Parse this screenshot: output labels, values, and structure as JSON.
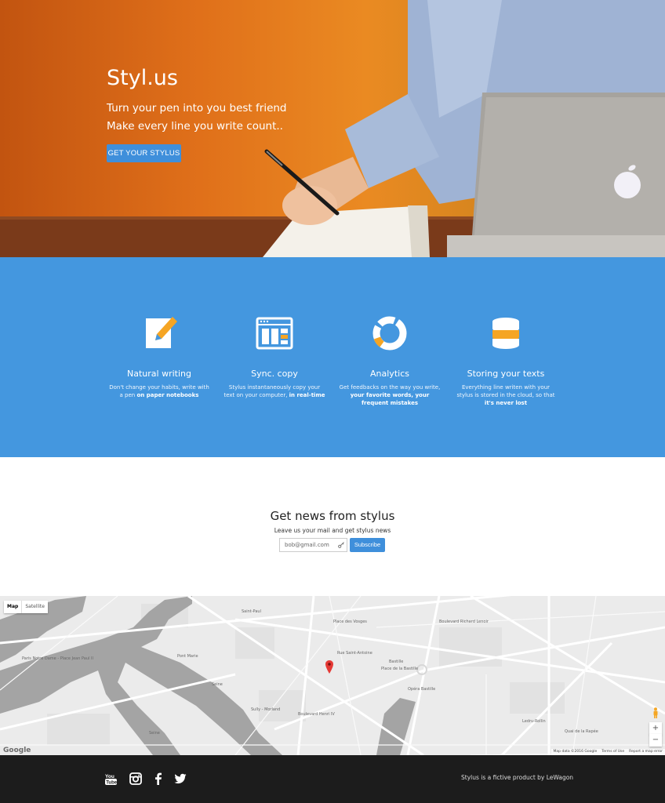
{
  "hero": {
    "title": "Styl.us",
    "line1": "Turn your pen into you best friend",
    "line2": "Make every line you write count..",
    "cta_label": "GET YOUR STYLUS"
  },
  "features": [
    {
      "icon": "pencil-note-icon",
      "title": "Natural writing",
      "text": "Don't change your habits, write with a pen ",
      "bold": "on paper notebooks"
    },
    {
      "icon": "layout-window-icon",
      "title": "Sync. copy",
      "text": "Stylus instantaneously copy your text on your computer, ",
      "bold": "in real-time"
    },
    {
      "icon": "donut-chart-icon",
      "title": "Analytics",
      "text": "Get feedbacks on the way you write, ",
      "bold": "your favorite words, your frequent mistakes"
    },
    {
      "icon": "database-icon",
      "title": "Storing your texts",
      "text": "Everything line writen with your stylus is stored in the cloud, so that ",
      "bold": "it's never lost"
    }
  ],
  "newsletter": {
    "title": "Get news from stylus",
    "subtitle": "Leave us your mail and get stylus news",
    "input_value": "bob@gmail.com",
    "button_label": "Subscribe"
  },
  "map": {
    "type_map": "Map",
    "type_satellite": "Satellite",
    "zoom_in": "+",
    "zoom_out": "−",
    "google": "Google",
    "footer_data": "Map data ©2016 Google",
    "footer_terms": "Terms of Use",
    "footer_report": "Report a map error",
    "labels": {
      "saint_paul": "Saint-Paul",
      "pont_marie": "Pont Marie",
      "bastille": "Bastille",
      "ledru_rollin": "Ledru-Rollin",
      "seine_1": "Seine",
      "seine_2": "Seine",
      "notre_dame": "Paris Notre Dame - Place Jean Paul II",
      "rue_saint_antoine": "Rue Saint-Antoine",
      "place_de_la_bastille": "Place de la Bastille",
      "place_des_vosges": "Place des Vosges",
      "boulevard_henri_iv": "Boulevard Henri IV",
      "boulevard_richard_lenoir": "Boulevard Richard Lenoir",
      "opera_bastille": "Opéra Bastille",
      "sully_morland": "Sully - Morland",
      "gare_de_lyon": "Quai de la Rapée"
    }
  },
  "footer": {
    "text": "Stylus is a fictive product by LeWagon",
    "social": [
      "youtube-icon",
      "instagram-icon",
      "facebook-icon",
      "twitter-icon"
    ]
  },
  "colors": {
    "accent": "#3f8fdb",
    "features_bg": "#4497df",
    "footer_bg": "#1c1c1c",
    "hero_orange": "#e0701a",
    "feature_icon_orange": "#f5a524"
  }
}
